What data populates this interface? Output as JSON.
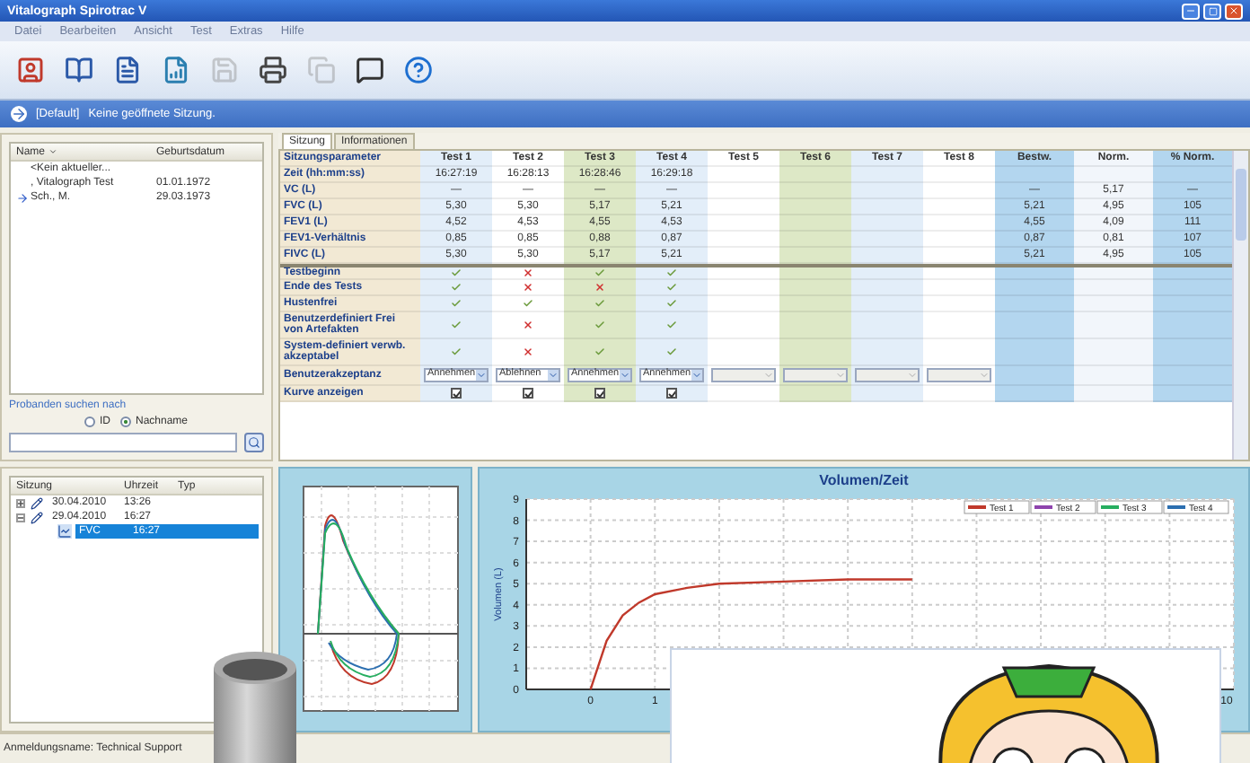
{
  "window": {
    "title": "Vitalograph Spirotrac V"
  },
  "menu": [
    "Datei",
    "Bearbeiten",
    "Ansicht",
    "Test",
    "Extras",
    "Hilfe"
  ],
  "toolbar": [
    {
      "kind": "patient",
      "disabled": false
    },
    {
      "kind": "book",
      "disabled": false
    },
    {
      "kind": "report",
      "disabled": false
    },
    {
      "kind": "chart",
      "disabled": false
    },
    {
      "kind": "save",
      "disabled": true
    },
    {
      "kind": "print",
      "disabled": false
    },
    {
      "kind": "copy",
      "disabled": true
    },
    {
      "kind": "tag",
      "disabled": false
    },
    {
      "kind": "help",
      "disabled": false
    }
  ],
  "info_bar": {
    "profile": "[Default]",
    "message": "Keine geöffnete Sitzung."
  },
  "patients": {
    "columns": [
      "Name",
      "Geburtsdatum"
    ],
    "rows": [
      {
        "name": "<Kein aktueller...",
        "birth": null,
        "selected": false
      },
      {
        "name": ", Vitalograph Test",
        "birth": "01.01.1972",
        "selected": false
      },
      {
        "name": "Sch., M.",
        "birth": "29.03.1973",
        "selected": true
      }
    ],
    "search": {
      "label": "Probanden suchen nach",
      "options": [
        {
          "label": "ID",
          "selected": false
        },
        {
          "label": "Nachname",
          "selected": true
        }
      ]
    }
  },
  "sessions": {
    "columns": [
      "Sitzung",
      "Uhrzeit",
      "Typ"
    ],
    "items": [
      {
        "label": "30.04.2010",
        "time": "13:26",
        "expanded": false,
        "selected": false
      },
      {
        "label": "29.04.2010",
        "time": "16:27",
        "expanded": true,
        "selected": false,
        "children": [
          {
            "label": "FVC",
            "time": "16:27",
            "selected": true
          }
        ]
      }
    ]
  },
  "tabs": [
    {
      "label": "Sitzung",
      "selected": true
    },
    {
      "label": "Informationen",
      "selected": false
    }
  ],
  "table": {
    "columns": [
      "Sitzungsparameter",
      "Test 1",
      "Test 2",
      "Test 3",
      "Test 4",
      "Test 5",
      "Test 6",
      "Test 7",
      "Test 8",
      "Bestw.",
      "Norm.",
      "% Norm."
    ],
    "rows": [
      {
        "kind": "value",
        "label": "Zeit (hh:mm:ss)",
        "cells": [
          "16:27:19",
          "16:28:13",
          "16:28:46",
          "16:29:18"
        ]
      },
      {
        "kind": "value",
        "label": "VC (L)",
        "cells": [
          "—",
          "—",
          "—",
          "—"
        ],
        "best": "—",
        "norm": "5,17",
        "percent": "—"
      },
      {
        "kind": "value",
        "label": "FVC (L)",
        "cells": [
          "5,30",
          "5,30",
          "5,17",
          "5,21"
        ],
        "best": "5,21",
        "norm": "4,95",
        "percent": "105"
      },
      {
        "kind": "value",
        "label": "FEV1 (L)",
        "cells": [
          "4,52",
          "4,53",
          "4,55",
          "4,53"
        ],
        "best": "4,55",
        "norm": "4,09",
        "percent": "111"
      },
      {
        "kind": "value",
        "label": "FEV1-Verhältnis",
        "cells": [
          "0,85",
          "0,85",
          "0,88",
          "0,87"
        ],
        "best": "0,87",
        "norm": "0,81",
        "percent": "107"
      },
      {
        "kind": "value",
        "label": "FIVC (L)",
        "cells": [
          "5,30",
          "5,30",
          "5,17",
          "5,21"
        ],
        "best": "5,21",
        "norm": "4,95",
        "percent": "105"
      },
      {
        "kind": "check",
        "label": "Testbeginn",
        "checks": [
          true,
          false,
          true,
          true
        ]
      },
      {
        "kind": "check",
        "label": "Ende des Tests",
        "checks": [
          true,
          false,
          false,
          true
        ]
      },
      {
        "kind": "check",
        "label": "Hustenfrei",
        "checks": [
          true,
          true,
          true,
          true
        ]
      },
      {
        "kind": "check",
        "label": "Benutzerdefiniert Frei von Artefakten",
        "checks": [
          true,
          false,
          true,
          true
        ]
      },
      {
        "kind": "check",
        "label": "System-definiert verwb. akzeptabel",
        "checks": [
          true,
          false,
          true,
          true
        ]
      },
      {
        "kind": "select",
        "label": "Benutzerakzeptanz",
        "choices": [
          "Annehmen",
          "Ablehnen",
          "Annehmen",
          "Annehmen"
        ]
      },
      {
        "kind": "toggle",
        "label": "Kurve anzeigen",
        "checked": [
          true,
          true,
          true,
          true
        ]
      }
    ]
  },
  "volume_chart": {
    "title": "Volumen/Zeit",
    "legend_items": [
      {
        "label": "Test 2",
        "color": "#8e44ad"
      },
      {
        "label": "Test 3",
        "color": "#27ae60"
      },
      {
        "label": "Test 4",
        "color": "#2c6fb0"
      }
    ],
    "chart_data": {
      "type": "line",
      "ylabel": "Volumen (L)",
      "xlim": [
        -1,
        10
      ],
      "ylim": [
        0,
        9
      ],
      "xticks": [
        0,
        1,
        10
      ],
      "yticks": [
        0,
        1,
        2,
        3,
        4,
        5,
        6,
        7,
        8,
        9
      ],
      "grid": true,
      "legend": "upper right",
      "x": [
        0,
        0.25,
        0.5,
        0.75,
        1,
        1.5,
        2,
        3,
        4,
        5
      ],
      "series": [
        {
          "name": "Test 1",
          "color": "#c0392b",
          "values": [
            0,
            2.3,
            3.5,
            4.1,
            4.5,
            4.8,
            5.0,
            5.1,
            5.2,
            5.2
          ]
        }
      ]
    }
  },
  "status_bar": "Anmeldungsname: Technical Support"
}
